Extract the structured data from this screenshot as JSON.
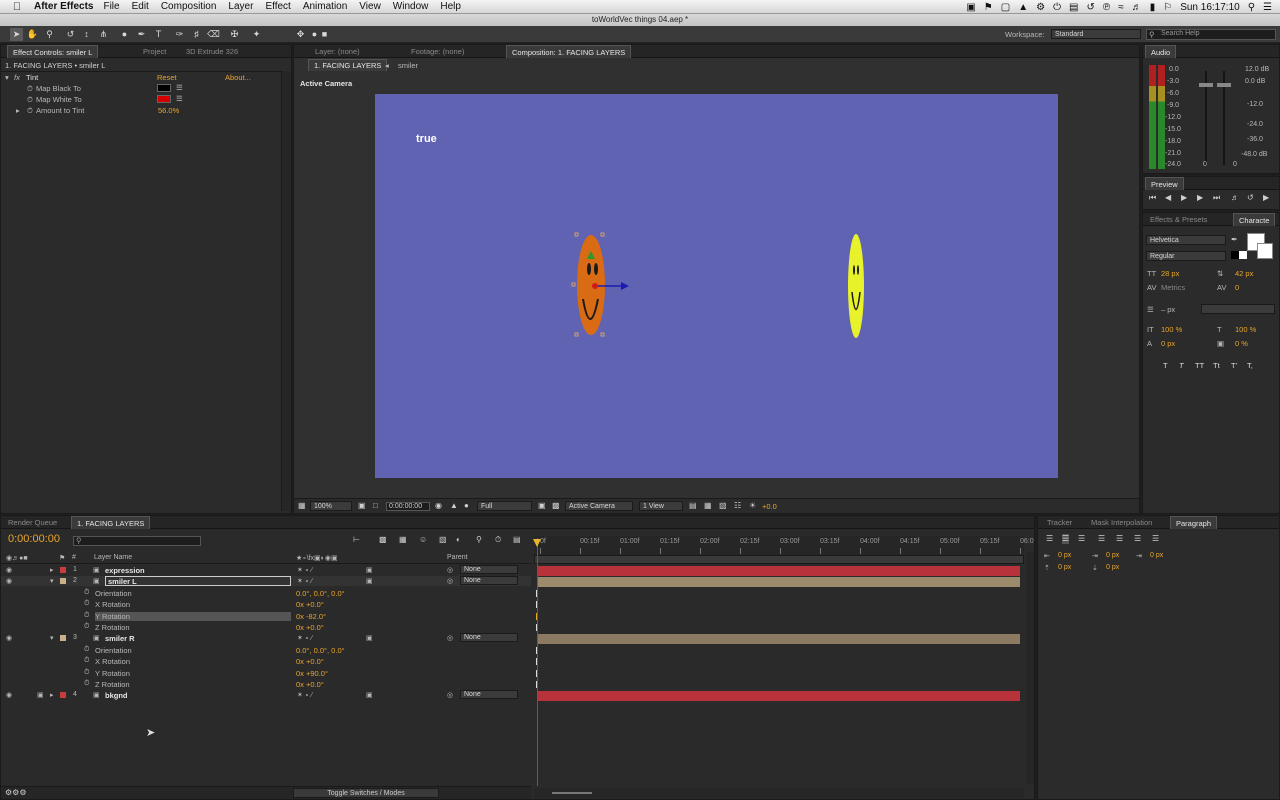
{
  "menubar": {
    "app_name": "After Effects",
    "items": [
      "File",
      "Edit",
      "Composition",
      "Layer",
      "Effect",
      "Animation",
      "View",
      "Window",
      "Help"
    ],
    "clock": "Sun 16:17:10"
  },
  "window_title": "toWorldVec things 04.aep *",
  "toolbar": {
    "workspace_label": "Workspace:",
    "workspace_value": "Standard",
    "search_placeholder": "Search Help"
  },
  "effect_controls": {
    "tab_label": "Effect Controls: smiler L",
    "tab_project": "Project",
    "tab_extrude": "3D Extrude 326",
    "breadcrumb": "1. FACING LAYERS • smiler L",
    "effect_name": "Tint",
    "reset_label": "Reset",
    "about_label": "About...",
    "props": [
      {
        "name": "Map Black To",
        "color": "#000000"
      },
      {
        "name": "Map White To",
        "color": "#d40000"
      },
      {
        "name": "Amount to Tint",
        "value": "56.0%"
      }
    ]
  },
  "viewer": {
    "tabs": [
      "Layer: (none)",
      "Footage: (none)",
      "Composition: 1. FACING LAYERS"
    ],
    "flow": [
      "1. FACING LAYERS",
      "smiler"
    ],
    "camera_label": "Active Camera",
    "comp_text": "true",
    "bg_color": "#6062b2",
    "zoom": "100%",
    "timecode": "0:00:00:00",
    "resolution": "Full",
    "camera_select": "Active Camera",
    "view_select": "1 View",
    "exposure": "+0.0"
  },
  "audio": {
    "tab": "Audio",
    "left_scale": [
      "0.0",
      "-3.0",
      "-6.0",
      "-9.0",
      "-12.0",
      "-15.0",
      "-18.0",
      "-21.0",
      "-24.0"
    ],
    "right_scale": [
      "12.0 dB",
      "0.0 dB",
      "-12.0",
      "-24.0",
      "-36.0",
      "-48.0 dB"
    ],
    "bottom_values": [
      "0",
      "0"
    ]
  },
  "preview": {
    "tab": "Preview"
  },
  "character": {
    "tabs": [
      "Effects & Presets",
      "Characte"
    ],
    "font": "Helvetica",
    "style": "Regular",
    "size": "28 px",
    "leading": "42 px",
    "kerning": "Metrics",
    "tracking": "0",
    "stroke": "– px",
    "vscale": "100 %",
    "hscale": "100 %",
    "baseline": "0 px",
    "tsume": "0 %",
    "styles": [
      "T",
      "T",
      "TT",
      "Tt",
      "T'",
      "T,"
    ]
  },
  "paragraph": {
    "tabs": [
      "Tracker",
      "Mask Interpolation",
      "Paragraph"
    ],
    "values": [
      "0 px",
      "0 px",
      "0 px",
      "0 px",
      "0 px"
    ]
  },
  "timeline": {
    "tabs": [
      "Render Queue",
      "1. FACING LAYERS"
    ],
    "timecode": "0:00:00:00",
    "col_layer_name": "Layer Name",
    "col_parent": "Parent",
    "ruler": [
      "0f",
      "00:15f",
      "01:00f",
      "01:15f",
      "02:00f",
      "02:15f",
      "03:00f",
      "03:15f",
      "04:00f",
      "04:15f",
      "05:00f",
      "05:15f",
      "06:0"
    ],
    "toggle_label": "Toggle Switches / Modes",
    "layers": [
      {
        "num": "1",
        "name": "expression",
        "label_color": "#c83c3c",
        "parent": "None",
        "bar_color": "#b8323c"
      },
      {
        "num": "2",
        "name": "smiler L",
        "label_color": "#c9b08a",
        "parent": "None",
        "bar_color": "#9c8a6c",
        "props": [
          {
            "name": "Orientation",
            "value": "0.0°, 0.0°, 0.0°"
          },
          {
            "name": "X Rotation",
            "value": "0x +0.0°"
          },
          {
            "name": "Y Rotation",
            "value": "0x -82.0°"
          },
          {
            "name": "Z Rotation",
            "value": "0x +0.0°"
          }
        ]
      },
      {
        "num": "3",
        "name": "smiler R",
        "label_color": "#c9b08a",
        "parent": "None",
        "bar_color": "#8c7a62",
        "props": [
          {
            "name": "Orientation",
            "value": "0.0°, 0.0°, 0.0°"
          },
          {
            "name": "X Rotation",
            "value": "0x +0.0°"
          },
          {
            "name": "Y Rotation",
            "value": "0x +90.0°"
          },
          {
            "name": "Z Rotation",
            "value": "0x +0.0°"
          }
        ]
      },
      {
        "num": "4",
        "name": "bkgnd",
        "label_color": "#c83c3c",
        "parent": "None",
        "bar_color": "#b8323c"
      }
    ]
  }
}
